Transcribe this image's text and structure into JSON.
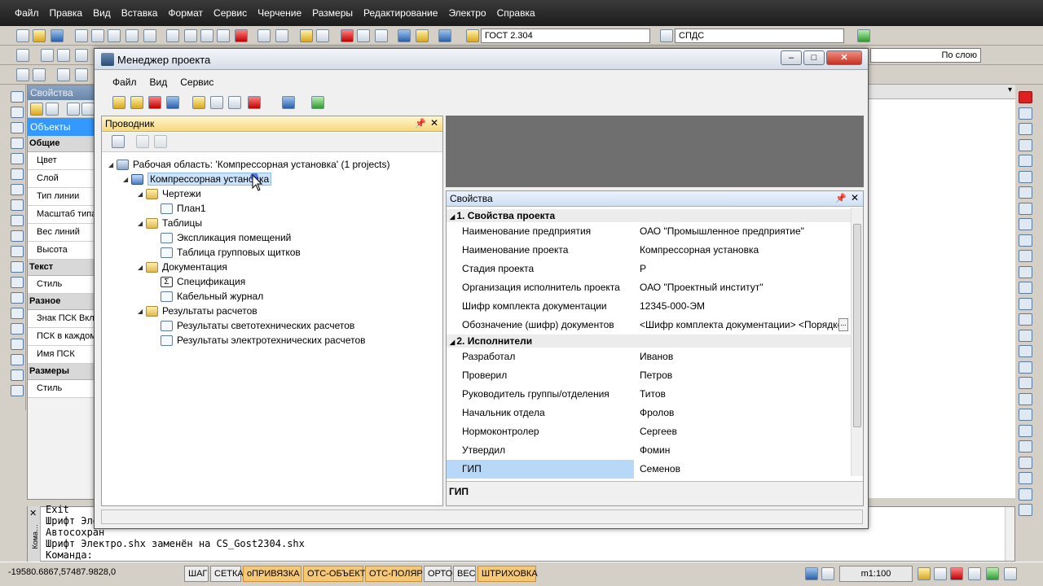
{
  "main_menu": [
    "Файл",
    "Правка",
    "Вид",
    "Вставка",
    "Формат",
    "Сервис",
    "Черчение",
    "Размеры",
    "Редактирование",
    "Электро",
    "Справка"
  ],
  "toolbar": {
    "text_style": "ГОСТ 2.304",
    "dim_style": "СПДС",
    "lineweight": "По слою"
  },
  "left_palette": {
    "title": "Свойства",
    "selection": "Объекты",
    "sections": [
      {
        "name": "Общие",
        "items": [
          "Цвет",
          "Слой",
          "Тип линии",
          "Масштаб типа",
          "Вес линий",
          "Высота"
        ]
      },
      {
        "name": "Текст",
        "items": [
          "Стиль"
        ]
      },
      {
        "name": "Разное",
        "items": [
          "Знак ПСК Вкл",
          "ПСК в каждом",
          "Имя ПСК"
        ]
      },
      {
        "name": "Размеры",
        "items": [
          "Стиль"
        ]
      }
    ]
  },
  "dialog": {
    "title": "Менеджер проекта",
    "menu": [
      "Файл",
      "Вид",
      "Сервис"
    ],
    "explorer": {
      "title": "Проводник",
      "tree": [
        {
          "level": 0,
          "icon": "workspace",
          "label": "Рабочая область: 'Компрессорная установка' (1 projects)"
        },
        {
          "level": 1,
          "icon": "project",
          "label": "Компрессорная установка",
          "selected": true
        },
        {
          "level": 2,
          "icon": "folder",
          "label": "Чертежи"
        },
        {
          "level": 3,
          "icon": "doc",
          "label": "План1"
        },
        {
          "level": 2,
          "icon": "folder",
          "label": "Таблицы"
        },
        {
          "level": 3,
          "icon": "doc",
          "label": "Экспликация помещений"
        },
        {
          "level": 3,
          "icon": "doc",
          "label": "Таблица групповых щитков"
        },
        {
          "level": 2,
          "icon": "folder",
          "label": "Документация"
        },
        {
          "level": 3,
          "icon": "sum",
          "label": "Спецификация"
        },
        {
          "level": 3,
          "icon": "doc",
          "label": "Кабельный журнал"
        },
        {
          "level": 2,
          "icon": "folder",
          "label": "Результаты расчетов"
        },
        {
          "level": 3,
          "icon": "doc",
          "label": "Результаты светотехнических расчетов"
        },
        {
          "level": 3,
          "icon": "doc",
          "label": "Результаты электротехнических расчетов"
        }
      ]
    },
    "properties": {
      "title": "Свойства",
      "sections": [
        {
          "name": "1. Свойства проекта",
          "rows": [
            {
              "key": "Наименование предприятия",
              "value": "ОАО \"Промышленное предприятие\""
            },
            {
              "key": "Наименование проекта",
              "value": "Компрессорная установка"
            },
            {
              "key": "Стадия проекта",
              "value": "Р"
            },
            {
              "key": "Организация исполнитель проекта",
              "value": "ОАО \"Проектный институт\""
            },
            {
              "key": "Шифр комплекта документации",
              "value": "12345-000-ЭМ"
            },
            {
              "key": "Обозначение (шифр) документов",
              "value": "<Шифр комплекта документации> <Порядковый номер>"
            }
          ]
        },
        {
          "name": "2. Исполнители",
          "rows": [
            {
              "key": "Разработал",
              "value": "Иванов"
            },
            {
              "key": "Проверил",
              "value": "Петров"
            },
            {
              "key": "Руководитель группы/отделения",
              "value": "Титов"
            },
            {
              "key": "Начальник отдела",
              "value": "Фролов"
            },
            {
              "key": "Нормоконтролер",
              "value": "Сергеев"
            },
            {
              "key": "Утвердил",
              "value": "Фомин"
            },
            {
              "key": "ГИП",
              "value": "Семенов",
              "selected": true
            }
          ]
        }
      ],
      "description_title": "ГИП"
    }
  },
  "command_window": {
    "label": "Кома…",
    "lines": [
      "Exit",
      "Шрифт Элек",
      "Автосохран",
      "Шрифт Электро.shx заменён на CS_Gost2304.shx"
    ],
    "prompt": "Команда:"
  },
  "status": {
    "coords": "-19580.6867,57487.9828,0",
    "toggles": [
      {
        "label": "ШАГ",
        "on": false
      },
      {
        "label": "СЕТКА",
        "on": false
      },
      {
        "label": "оПРИВЯЗКА",
        "on": true
      },
      {
        "label": "ОТС-ОБЪЕКТ",
        "on": true
      },
      {
        "label": "ОТС-ПОЛЯР",
        "on": true
      },
      {
        "label": "ОРТО",
        "on": false
      },
      {
        "label": "ВЕС",
        "on": false
      },
      {
        "label": "ШТРИХОВКА",
        "on": true
      }
    ],
    "scale": "m1:100"
  },
  "colors": {
    "accent": "#3399ff",
    "titlebar": "#1c1c1c",
    "status_on": "#f5c878"
  }
}
